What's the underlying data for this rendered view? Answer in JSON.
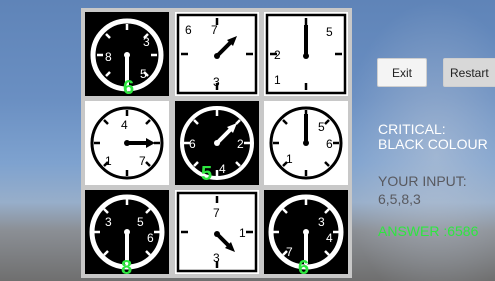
{
  "buttons": {
    "exit": "Exit",
    "restart": "Restart"
  },
  "status": {
    "critical_label": "CRITICAL:",
    "critical_value": "BLACK COLOUR",
    "input_label": "YOUR INPUT:",
    "input_value": "6,5,8,3",
    "answer": "ANSWER :6586"
  },
  "colors": {
    "answer": "#2ee640",
    "tile_dark": "#000000",
    "tile_light": "#ffffff",
    "highlight_number": "#2ee640"
  },
  "clocks": [
    {
      "style": "black",
      "face": "round",
      "numbers": [
        "3",
        "5",
        "8"
      ],
      "highlight": "6"
    },
    {
      "style": "white",
      "face": "square",
      "numbers": [
        "6",
        "7",
        "3"
      ],
      "highlight": ""
    },
    {
      "style": "white",
      "face": "square",
      "numbers": [
        "5",
        "2",
        "1"
      ],
      "highlight": ""
    },
    {
      "style": "white",
      "face": "round",
      "numbers": [
        "4",
        "1",
        "7"
      ],
      "highlight": ""
    },
    {
      "style": "black",
      "face": "round",
      "numbers": [
        "6",
        "2",
        "4"
      ],
      "highlight": "5"
    },
    {
      "style": "white",
      "face": "round",
      "numbers": [
        "5",
        "6",
        "1"
      ],
      "highlight": ""
    },
    {
      "style": "black",
      "face": "round",
      "numbers": [
        "3",
        "5",
        "6"
      ],
      "highlight": "8"
    },
    {
      "style": "white",
      "face": "square",
      "numbers": [
        "7",
        "1",
        "3"
      ],
      "highlight": ""
    },
    {
      "style": "black",
      "face": "round",
      "numbers": [
        "3",
        "4",
        "7"
      ],
      "highlight": "6"
    }
  ]
}
